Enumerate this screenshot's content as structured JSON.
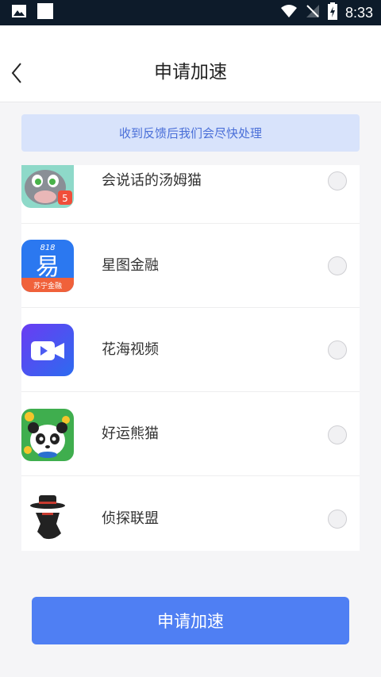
{
  "status_bar": {
    "time": "8:33",
    "icons": [
      "image-icon",
      "notification-square-icon",
      "wifi-icon",
      "no-signal-icon",
      "battery-charging-icon"
    ]
  },
  "header": {
    "title": "申请加速",
    "back_icon": "chevron-left-icon"
  },
  "notice": {
    "text": "收到反馈后我们会尽快处理"
  },
  "apps": [
    {
      "name": "会说话的汤姆猫",
      "selected": false,
      "icon": "tom-cat-app-icon"
    },
    {
      "name": "星图金融",
      "selected": false,
      "icon": "xingtu-finance-app-icon",
      "icon_text_top": "818",
      "icon_text_main": "易",
      "icon_text_bottom": "苏宁金融"
    },
    {
      "name": "花海视频",
      "selected": false,
      "icon": "video-camera-app-icon"
    },
    {
      "name": "好运熊猫",
      "selected": false,
      "icon": "panda-app-icon"
    },
    {
      "name": "侦探联盟",
      "selected": false,
      "icon": "detective-app-icon"
    }
  ],
  "submit_button": {
    "label": "申请加速"
  },
  "colors": {
    "accent": "#4f7ff3",
    "notice_bg": "#d8e3fb",
    "notice_text": "#4a6fd8",
    "status_bar": "#0d1b2a"
  }
}
